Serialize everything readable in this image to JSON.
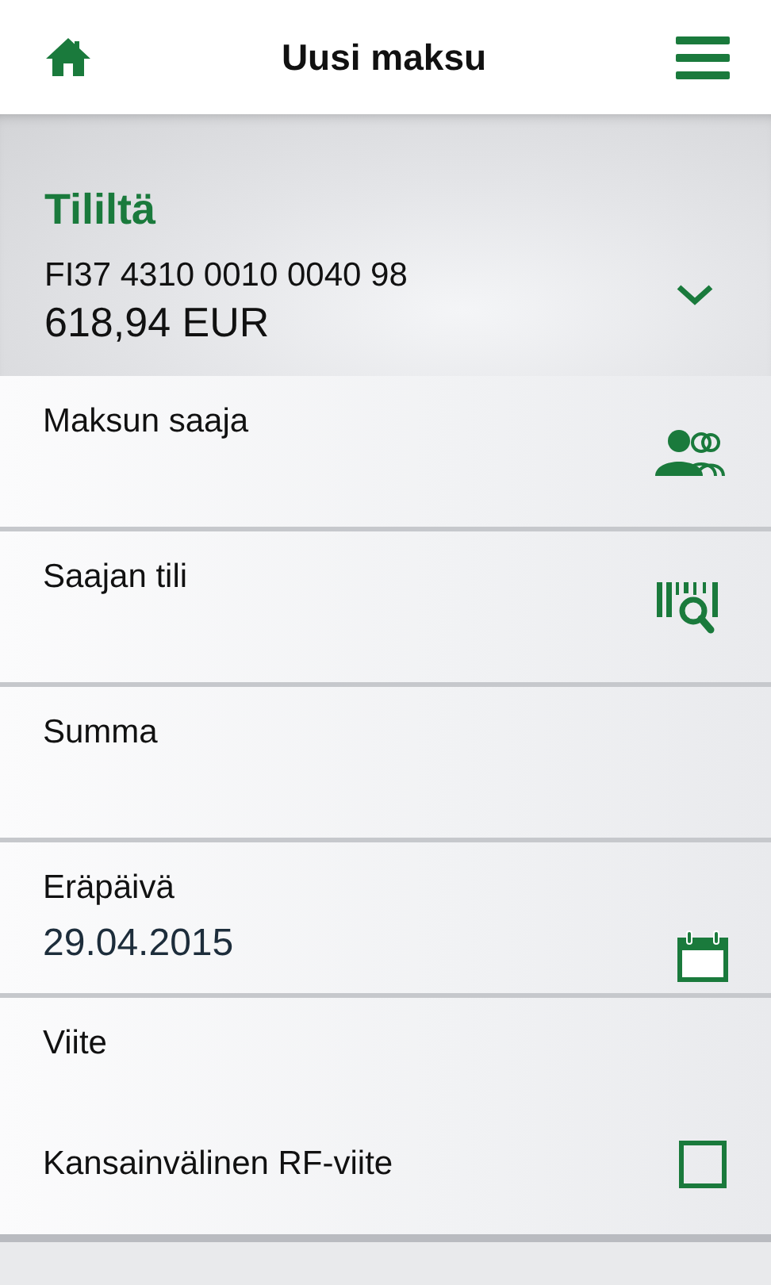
{
  "header": {
    "title": "Uusi maksu"
  },
  "account": {
    "heading": "Tililtä",
    "iban": "FI37 4310 0010 0040 98",
    "balance": "618,94 EUR"
  },
  "fields": [
    {
      "kind": "payee",
      "label": "Maksun saaja"
    },
    {
      "kind": "account",
      "label": "Saajan tili"
    },
    {
      "kind": "text",
      "label": "Summa"
    },
    {
      "kind": "date",
      "label": "Eräpäivä",
      "value": "29.04.2015"
    }
  ],
  "reference": {
    "label": "Viite",
    "rf_option": {
      "label": "Kansainvälinen RF-viite",
      "checked": false
    }
  }
}
